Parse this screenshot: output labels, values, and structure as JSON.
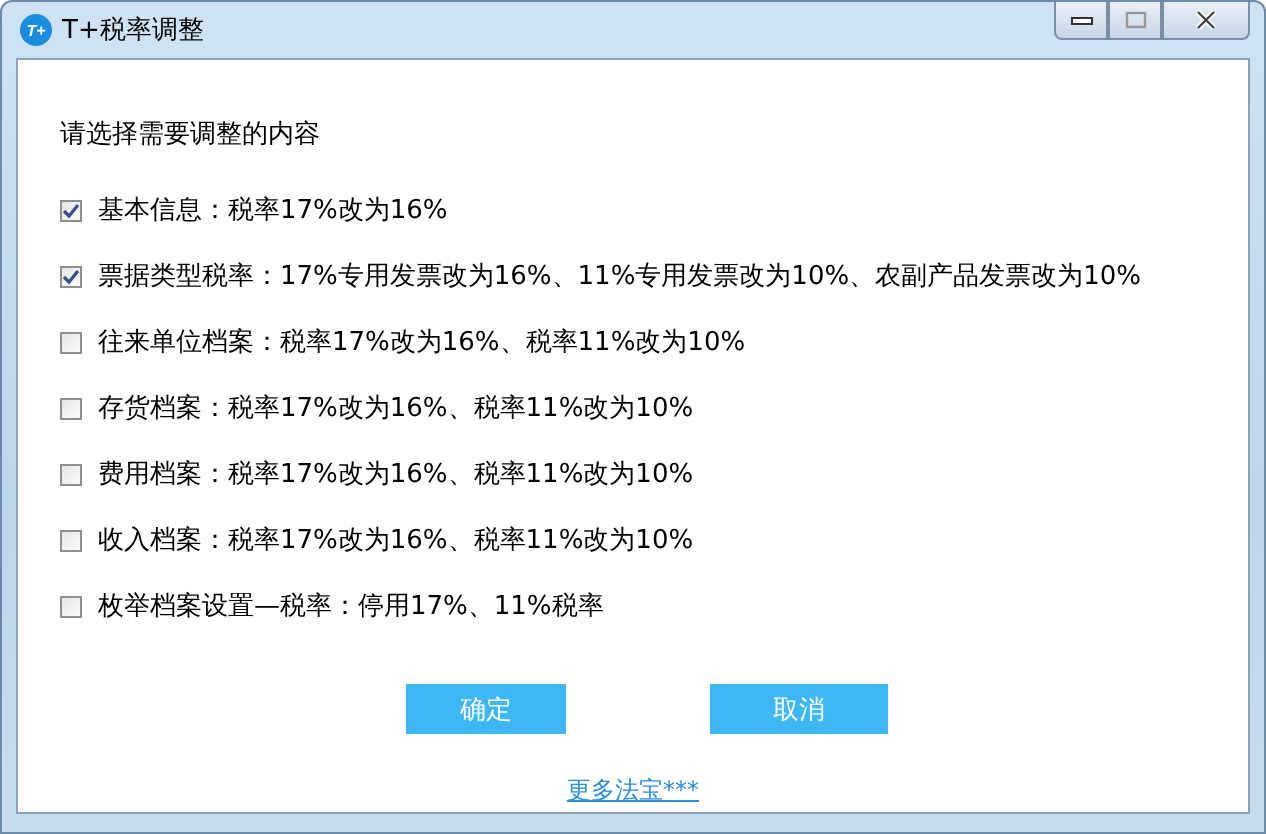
{
  "window": {
    "title": "T+税率调整",
    "logo_text": "T+"
  },
  "prompt": "请选择需要调整的内容",
  "options": [
    {
      "label": "基本信息：税率17%改为16%",
      "checked": true
    },
    {
      "label": "票据类型税率：17%专用发票改为16%、11%专用发票改为10%、农副产品发票改为10%",
      "checked": true
    },
    {
      "label": "往来单位档案：税率17%改为16%、税率11%改为10%",
      "checked": false
    },
    {
      "label": "存货档案：税率17%改为16%、税率11%改为10%",
      "checked": false
    },
    {
      "label": "费用档案：税率17%改为16%、税率11%改为10%",
      "checked": false
    },
    {
      "label": "收入档案：税率17%改为16%、税率11%改为10%",
      "checked": false
    },
    {
      "label": "枚举档案设置—税率：停用17%、11%税率",
      "checked": false
    }
  ],
  "buttons": [
    "确定",
    "取消"
  ],
  "link": "更多法宝***"
}
